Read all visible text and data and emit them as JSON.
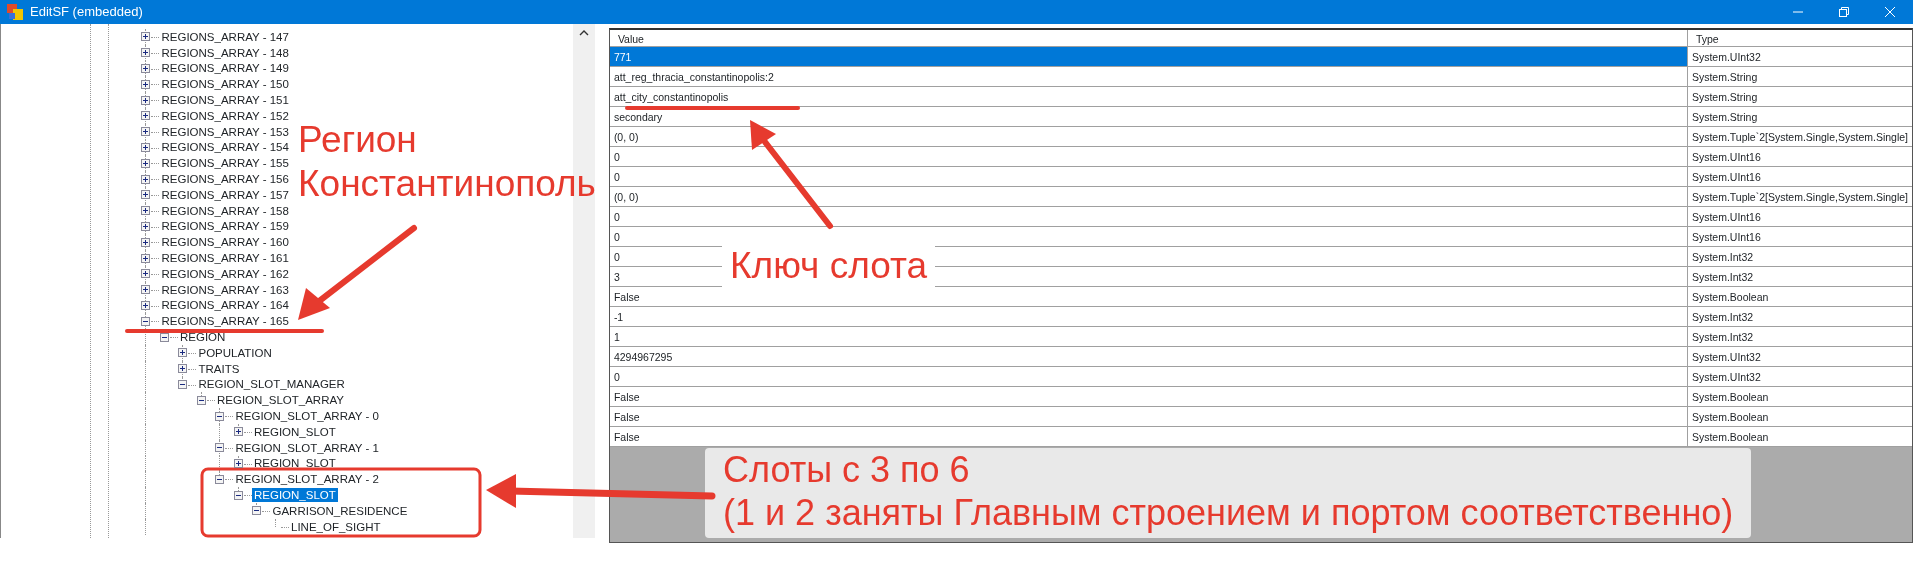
{
  "window": {
    "title": "EditSF (embedded)"
  },
  "tree": {
    "nodes": [
      {
        "label": "REGIONS_ARRAY - 147",
        "expanded": false,
        "selected": false
      },
      {
        "label": "REGIONS_ARRAY - 148",
        "expanded": false,
        "selected": false
      },
      {
        "label": "REGIONS_ARRAY - 149",
        "expanded": false,
        "selected": false
      },
      {
        "label": "REGIONS_ARRAY - 150",
        "expanded": false,
        "selected": false
      },
      {
        "label": "REGIONS_ARRAY - 151",
        "expanded": false,
        "selected": false
      },
      {
        "label": "REGIONS_ARRAY - 152",
        "expanded": false,
        "selected": false
      },
      {
        "label": "REGIONS_ARRAY - 153",
        "expanded": false,
        "selected": false
      },
      {
        "label": "REGIONS_ARRAY - 154",
        "expanded": false,
        "selected": false
      },
      {
        "label": "REGIONS_ARRAY - 155",
        "expanded": false,
        "selected": false
      },
      {
        "label": "REGIONS_ARRAY - 156",
        "expanded": false,
        "selected": false
      },
      {
        "label": "REGIONS_ARRAY - 157",
        "expanded": false,
        "selected": false
      },
      {
        "label": "REGIONS_ARRAY - 158",
        "expanded": false,
        "selected": false
      },
      {
        "label": "REGIONS_ARRAY - 159",
        "expanded": false,
        "selected": false
      },
      {
        "label": "REGIONS_ARRAY - 160",
        "expanded": false,
        "selected": false
      },
      {
        "label": "REGIONS_ARRAY - 161",
        "expanded": false,
        "selected": false
      },
      {
        "label": "REGIONS_ARRAY - 162",
        "expanded": false,
        "selected": false
      },
      {
        "label": "REGIONS_ARRAY - 163",
        "expanded": false,
        "selected": false
      },
      {
        "label": "REGIONS_ARRAY - 164",
        "expanded": false,
        "selected": false
      },
      {
        "label": "REGIONS_ARRAY - 165",
        "expanded": true,
        "selected": false,
        "children": [
          {
            "label": "REGION",
            "expanded": true,
            "selected": false,
            "children": [
              {
                "label": "POPULATION",
                "expanded": false,
                "selected": false
              },
              {
                "label": "TRAITS",
                "expanded": false,
                "selected": false
              },
              {
                "label": "REGION_SLOT_MANAGER",
                "expanded": true,
                "selected": false,
                "children": [
                  {
                    "label": "REGION_SLOT_ARRAY",
                    "expanded": true,
                    "selected": false,
                    "children": [
                      {
                        "label": "REGION_SLOT_ARRAY - 0",
                        "expanded": true,
                        "selected": false,
                        "children": [
                          {
                            "label": "REGION_SLOT",
                            "expanded": false,
                            "selected": false
                          }
                        ]
                      },
                      {
                        "label": "REGION_SLOT_ARRAY - 1",
                        "expanded": true,
                        "selected": false,
                        "children": [
                          {
                            "label": "REGION_SLOT",
                            "expanded": false,
                            "selected": false
                          }
                        ]
                      },
                      {
                        "label": "REGION_SLOT_ARRAY - 2",
                        "expanded": true,
                        "selected": false,
                        "children": [
                          {
                            "label": "REGION_SLOT",
                            "expanded": true,
                            "selected": true,
                            "children": [
                              {
                                "label": "GARRISON_RESIDENCE",
                                "expanded": true,
                                "selected": false,
                                "children": [
                                  {
                                    "label": "LINE_OF_SIGHT",
                                    "selected": false
                                  }
                                ]
                              }
                            ]
                          }
                        ]
                      }
                    ]
                  }
                ]
              }
            ]
          }
        ]
      }
    ]
  },
  "table": {
    "columns": [
      "Value",
      "Type"
    ],
    "rows": [
      {
        "value": "771",
        "type": "System.UInt32",
        "selected": true
      },
      {
        "value": "att_reg_thracia_constantinopolis:2",
        "type": "System.String",
        "selected": false
      },
      {
        "value": "att_city_constantinopolis",
        "type": "System.String",
        "selected": false
      },
      {
        "value": "secondary",
        "type": "System.String",
        "selected": false
      },
      {
        "value": "(0, 0)",
        "type": "System.Tuple`2[System.Single,System.Single]",
        "selected": false
      },
      {
        "value": "0",
        "type": "System.UInt16",
        "selected": false
      },
      {
        "value": "0",
        "type": "System.UInt16",
        "selected": false
      },
      {
        "value": "(0, 0)",
        "type": "System.Tuple`2[System.Single,System.Single]",
        "selected": false
      },
      {
        "value": "0",
        "type": "System.UInt16",
        "selected": false
      },
      {
        "value": "0",
        "type": "System.UInt16",
        "selected": false
      },
      {
        "value": "0",
        "type": "System.Int32",
        "selected": false
      },
      {
        "value": "3",
        "type": "System.Int32",
        "selected": false
      },
      {
        "value": "False",
        "type": "System.Boolean",
        "selected": false
      },
      {
        "value": "-1",
        "type": "System.Int32",
        "selected": false
      },
      {
        "value": "1",
        "type": "System.Int32",
        "selected": false
      },
      {
        "value": "4294967295",
        "type": "System.UInt32",
        "selected": false
      },
      {
        "value": "0",
        "type": "System.UInt32",
        "selected": false
      },
      {
        "value": "False",
        "type": "System.Boolean",
        "selected": false
      },
      {
        "value": "False",
        "type": "System.Boolean",
        "selected": false
      },
      {
        "value": "False",
        "type": "System.Boolean",
        "selected": false
      }
    ]
  },
  "annotations": {
    "region_note": [
      "Регион",
      "Константинополь"
    ],
    "key_note": [
      "Ключ слота"
    ],
    "slots_note": [
      "Слоты с 3 по 6",
      "(1 и 2 заняты Главным строением и портом соответственно)"
    ]
  }
}
